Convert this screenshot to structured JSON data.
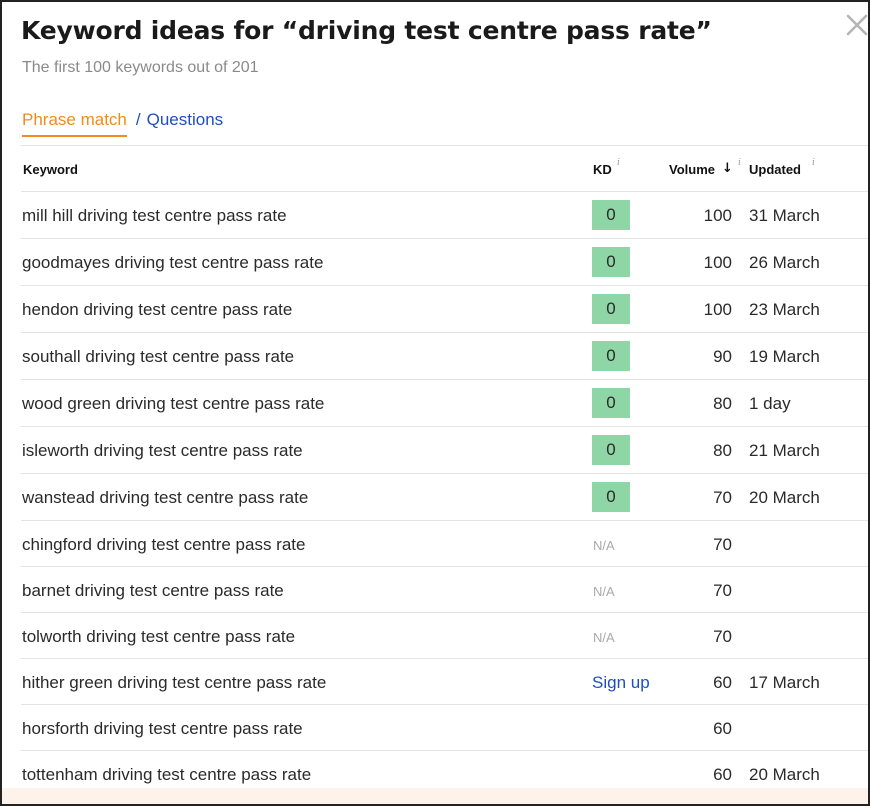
{
  "modal": {
    "title": "Keyword ideas for “driving test centre pass rate”",
    "subtitle": "The first 100 keywords out of 201",
    "close_glyph": "✕"
  },
  "tabs": {
    "active": "Phrase match",
    "separator": "/",
    "inactive": "Questions"
  },
  "columns": {
    "keyword": "Keyword",
    "kd": "KD",
    "volume": "Volume",
    "updated": "Updated",
    "info_glyph": "i",
    "sort_glyph": "↓"
  },
  "rows": [
    {
      "keyword": "mill hill driving test centre pass rate",
      "kd_type": "badge",
      "kd": "0",
      "volume": "100",
      "updated": "31 March"
    },
    {
      "keyword": "goodmayes driving test centre pass rate",
      "kd_type": "badge",
      "kd": "0",
      "volume": "100",
      "updated": "26 March"
    },
    {
      "keyword": "hendon driving test centre pass rate",
      "kd_type": "badge",
      "kd": "0",
      "volume": "100",
      "updated": "23 March"
    },
    {
      "keyword": "southall driving test centre pass rate",
      "kd_type": "badge",
      "kd": "0",
      "volume": "90",
      "updated": "19 March"
    },
    {
      "keyword": "wood green driving test centre pass rate",
      "kd_type": "badge",
      "kd": "0",
      "volume": "80",
      "updated": "1 day"
    },
    {
      "keyword": "isleworth driving test centre pass rate",
      "kd_type": "badge",
      "kd": "0",
      "volume": "80",
      "updated": "21 March"
    },
    {
      "keyword": "wanstead driving test centre pass rate",
      "kd_type": "badge",
      "kd": "0",
      "volume": "70",
      "updated": "20 March"
    },
    {
      "keyword": "chingford driving test centre pass rate",
      "kd_type": "na",
      "kd": "N/A",
      "volume": "70",
      "updated": ""
    },
    {
      "keyword": "barnet driving test centre pass rate",
      "kd_type": "na",
      "kd": "N/A",
      "volume": "70",
      "updated": ""
    },
    {
      "keyword": "tolworth driving test centre pass rate",
      "kd_type": "na",
      "kd": "N/A",
      "volume": "70",
      "updated": ""
    },
    {
      "keyword": "hither green driving test centre pass rate",
      "kd_type": "signup",
      "kd": "Sign up",
      "volume": "60",
      "updated": "17 March"
    },
    {
      "keyword": "horsforth driving test centre pass rate",
      "kd_type": "none",
      "kd": "",
      "volume": "60",
      "updated": ""
    },
    {
      "keyword": "tottenham driving test centre pass rate",
      "kd_type": "none",
      "kd": "",
      "volume": "60",
      "updated": "20 March"
    }
  ],
  "colors": {
    "accent_orange": "#f08c1e",
    "link_blue": "#1e4fbf",
    "kd_green": "#8fd6a7",
    "footer_tint": "#fdf3ea"
  }
}
